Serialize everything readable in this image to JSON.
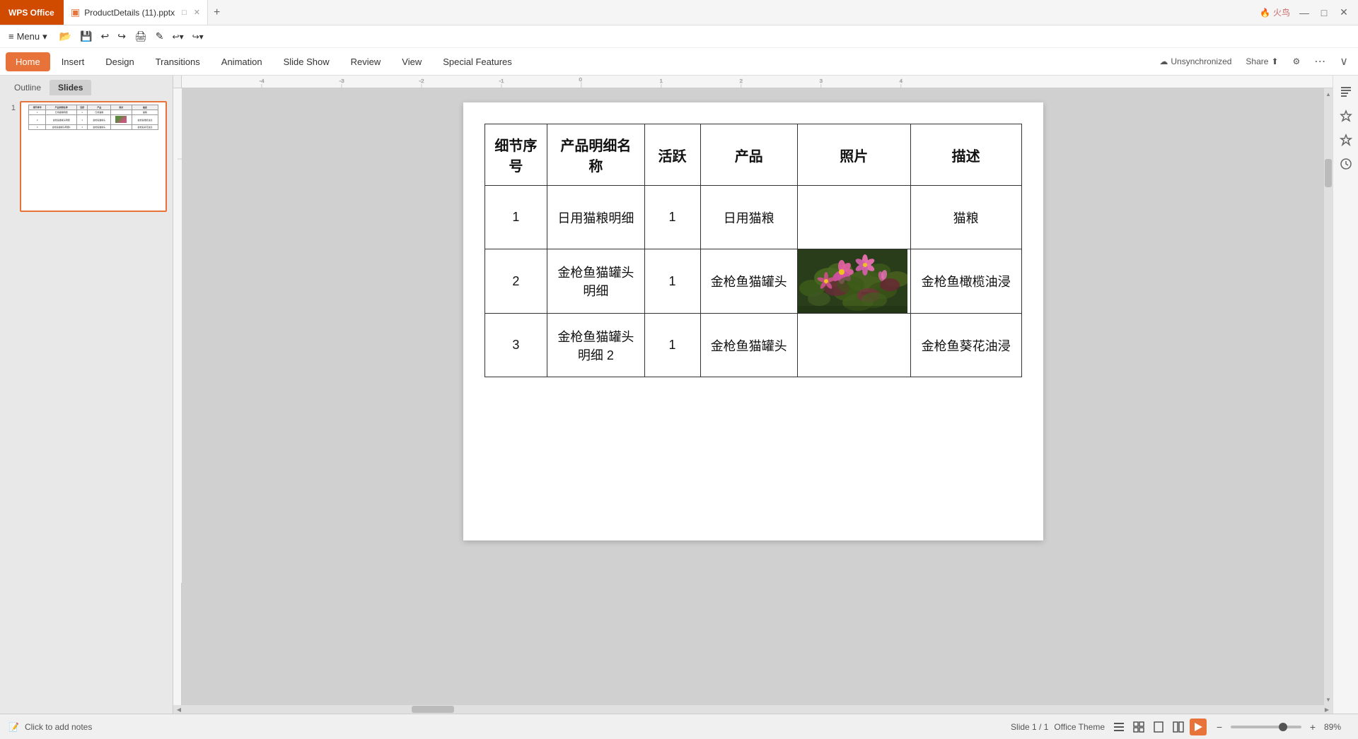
{
  "titlebar": {
    "wps_label": "WPS Office",
    "file_name": "ProductDetails (11).pptx",
    "minimize_icon": "—",
    "maximize_icon": "□",
    "close_icon": "✕",
    "new_tab_icon": "+"
  },
  "menubar": {
    "menu_icon": "≡",
    "menu_label": "Menu",
    "items": [
      "Home",
      "Insert",
      "Design",
      "Transitions",
      "Animation",
      "Slide Show",
      "Review",
      "View",
      "Special Features"
    ]
  },
  "ribbon_right": {
    "unsync_label": "Unsynchronized",
    "share_label": "Share",
    "more_icon": "⋯",
    "expand_icon": "∨"
  },
  "sidebar": {
    "outline_tab": "Outline",
    "slides_tab": "Slides",
    "slide_number": "1",
    "collapse_icon": "«"
  },
  "slide": {
    "table": {
      "headers": [
        "细节序号",
        "产品明细名称",
        "活跃",
        "产品",
        "照片",
        "描述"
      ],
      "rows": [
        {
          "id": "1",
          "name": "日用猫粮明细",
          "active": "1",
          "product": "日用猫粮",
          "has_photo": false,
          "desc": "猫粮"
        },
        {
          "id": "2",
          "name": "金枪鱼猫罐头明细",
          "active": "1",
          "product": "金枪鱼猫罐头",
          "has_photo": true,
          "desc": "金枪鱼橄榄油浸"
        },
        {
          "id": "3",
          "name": "金枪鱼猫罐头明细 2",
          "active": "1",
          "product": "金枪鱼猫罐头",
          "has_photo": false,
          "desc": "金枪鱼葵花油浸"
        }
      ]
    }
  },
  "bottombar": {
    "slide_info": "Slide 1 / 1",
    "theme": "Office Theme",
    "notes_icon": "📝",
    "notes_label": "Click to add notes",
    "zoom_level": "89%",
    "zoom_minus": "−",
    "zoom_plus": "+"
  },
  "view_buttons": [
    "≡≡",
    "⊞",
    "⊟",
    "⊠"
  ],
  "right_panel_icons": [
    "📋",
    "⚡",
    "⭐",
    "🕐"
  ]
}
